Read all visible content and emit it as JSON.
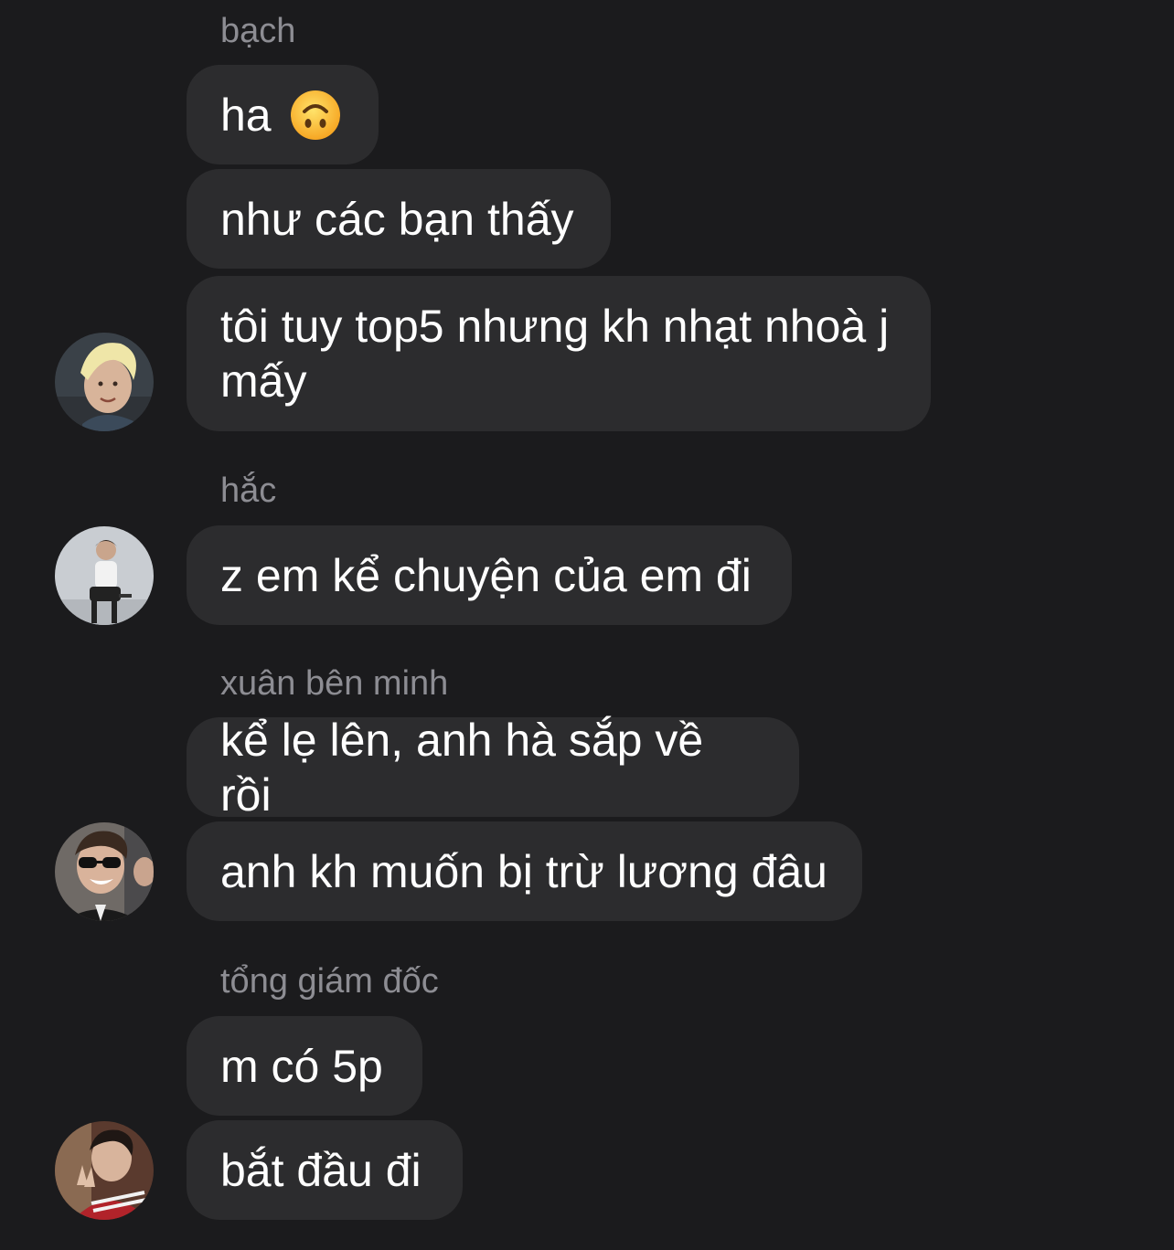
{
  "groups": [
    {
      "sender": "bạch",
      "messages": [
        {
          "text": "ha",
          "emoji": "upside-down-face-emoji"
        },
        {
          "text": "như các bạn thấy"
        },
        {
          "text": "tôi tuy top5 nhưng kh nhạt nhoà j mấy"
        }
      ]
    },
    {
      "sender": "hắc",
      "messages": [
        {
          "text": "z em kể chuyện của em đi"
        }
      ]
    },
    {
      "sender": "xuân bên minh",
      "messages": [
        {
          "text": "kể lẹ lên, anh hà sắp về rồi"
        },
        {
          "text": "anh kh muốn bị trừ lương đâu"
        }
      ]
    },
    {
      "sender": "tổng giám đốc",
      "messages": [
        {
          "text": "m có 5p"
        },
        {
          "text": "bắt đầu đi"
        }
      ]
    }
  ],
  "colors": {
    "background": "#1b1b1d",
    "bubble": "#2c2c2e",
    "message_text": "#ffffff",
    "sender_text": "#8d8d93"
  }
}
